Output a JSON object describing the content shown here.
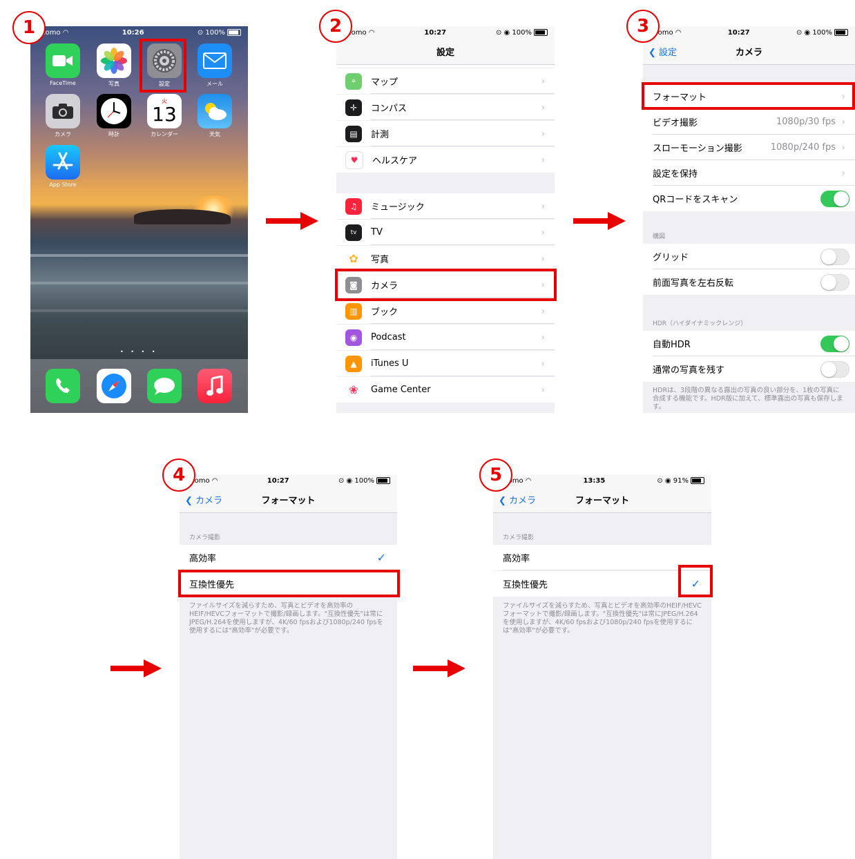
{
  "steps": [
    "1",
    "2",
    "3",
    "4",
    "5"
  ],
  "phone1": {
    "carrier": "ocomo",
    "time": "10:26",
    "battery": "100%",
    "apps_row1": [
      "FaceTime",
      "写真",
      "設定",
      "メール"
    ],
    "apps_row2": [
      "カメラ",
      "時計",
      "カレンダー",
      "天気"
    ],
    "apps_row3": [
      "App Store"
    ],
    "calendar_day": "火",
    "calendar_date": "13",
    "page_dots": "• • • •"
  },
  "phone2": {
    "carrier": "ocomo",
    "time": "10:27",
    "battery": "100%",
    "title": "設定",
    "group1": [
      "マップ",
      "コンパス",
      "計測",
      "ヘルスケア"
    ],
    "group2": [
      "ミュージック",
      "TV",
      "写真",
      "カメラ",
      "ブック",
      "Podcast",
      "iTunes U",
      "Game Center"
    ]
  },
  "phone3": {
    "carrier": "ocomo",
    "time": "10:27",
    "battery": "100%",
    "back": "設定",
    "title": "カメラ",
    "rows": {
      "format": "フォーマット",
      "video": "ビデオ撮影",
      "video_value": "1080p/30 fps",
      "slomo": "スローモーション撮影",
      "slomo_value": "1080p/240 fps",
      "preserve": "設定を保持",
      "qr": "QRコードをスキャン"
    },
    "section_composition": "構図",
    "grid": "グリッド",
    "mirror": "前面写真を左右反転",
    "section_hdr": "HDR（ハイダイナミックレンジ）",
    "auto_hdr": "自動HDR",
    "keep_normal": "通常の写真を残す",
    "hdr_footer": "HDRは、3段階の異なる露出の写真の良い部分を、1枚の写真に合成する機能です。HDR版に加えて、標準露出の写真も保存します。"
  },
  "phone4": {
    "carrier": "ocomo",
    "time": "10:27",
    "battery": "100%",
    "back": "カメラ",
    "title": "フォーマット",
    "section": "カメラ撮影",
    "opt_high": "高効率",
    "opt_compat": "互換性優先",
    "footer": "ファイルサイズを減らすため、写真とビデオを高効率のHEIF/HEVCフォーマットで撮影/録画します。\"互換性優先\"は常にJPEG/H.264を使用しますが、4K/60 fpsおよび1080p/240 fpsを使用するには\"高効率\"が必要です。",
    "check": "✓"
  },
  "phone5": {
    "carrier": "ocomo",
    "time": "13:35",
    "battery": "91%",
    "back": "カメラ",
    "title": "フォーマット",
    "section": "カメラ撮影",
    "opt_high": "高効率",
    "opt_compat": "互換性優先",
    "footer": "ファイルサイズを減らすため、写真とビデオを高効率のHEIF/HEVCフォーマットで撮影/録画します。\"互換性優先\"は常にJPEG/H.264を使用しますが、4K/60 fpsおよび1080p/240 fpsを使用するには\"高効率\"が必要です。",
    "check": "✓"
  },
  "colors": {
    "highlight": "#e60000",
    "ios_blue": "#1a73e8",
    "ios_green": "#34c759"
  }
}
